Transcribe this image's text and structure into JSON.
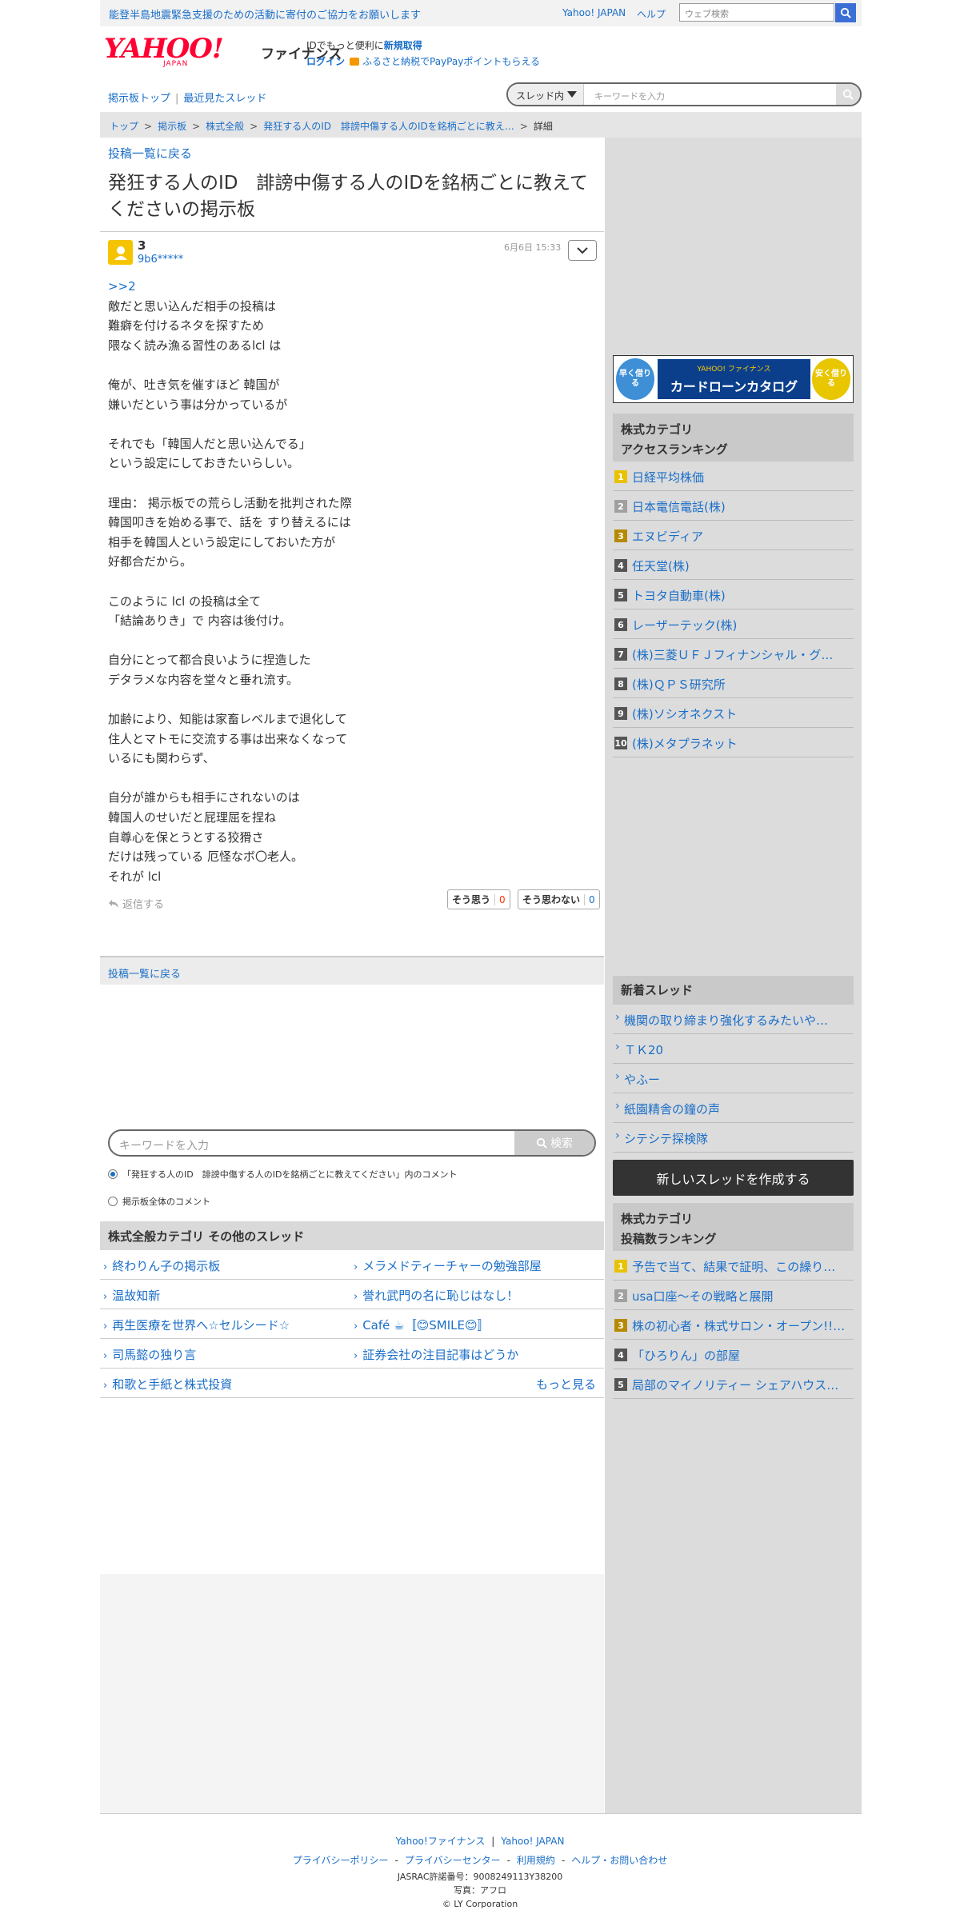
{
  "topbar": {
    "notice": "能登半島地震緊急支援のための活動に寄付のご協力をお願いします",
    "yahoo_japan": "Yahoo! JAPAN",
    "help": "ヘルプ",
    "web_search_placeholder": "ウェブ検索"
  },
  "header": {
    "logo": "YAHOO!",
    "logo_sub": "JAPAN",
    "service": "ファイナンス",
    "info_line1": "IDでもっと便利に",
    "info_signup": "新規取得",
    "info_login": "ログイン",
    "info_promo": "ふるさと納税でPayPayポイントもらえる"
  },
  "subnav": {
    "board_top": "掲示板トップ",
    "recent": "最近見たスレッド",
    "scope": "スレッド内",
    "keyword_placeholder": "キーワードを入力"
  },
  "breadcrumb": {
    "items": [
      "トップ",
      "掲示板",
      "株式全般",
      "発狂する人のID　誹謗中傷する人のIDを銘柄ごとに教え…"
    ],
    "current": "詳細"
  },
  "post": {
    "back_link": "投稿一覧に戻る",
    "title": "発狂する人のID　誹謗中傷する人のIDを銘柄ごとに教えてくださいの掲示板",
    "number": "3",
    "user_id": "9b6*****",
    "date": "6月6日 15:33",
    "anchor": ">>2",
    "body_lines": [
      "敵だと思い込んだ相手の投稿は",
      "難癖を付けるネタを探すため",
      "隈なく読み漁る習性のあるlcl は",
      "",
      "俺が、吐き気を催すほど 韓国が",
      "嫌いだという事は分かっているが",
      "",
      "それでも「韓国人だと思い込んでる」",
      "という設定にしておきたいらしい。",
      "",
      "理由： 掲示板での荒らし活動を批判された際",
      "韓国叩きを始める事で、話を すり替えるには",
      "相手を韓国人という設定にしておいた方が",
      "好都合だから。",
      "",
      "このように lcl の投稿は全て",
      "「結論ありき」で 内容は後付け。",
      "",
      "自分にとって都合良いように捏造した",
      "デタラメな内容を堂々と垂れ流す。",
      "",
      "加齢により、知能は家畜レベルまで退化して",
      "住人とマトモに交流する事は出来なくなって",
      "いるにも関わらず、",
      "",
      "自分が誰からも相手にされないのは",
      "韓国人のせいだと屁理屈を捏ね",
      "自尊心を保とうとする狡猾さ",
      "だけは残っている 厄怪なボ〇老人。",
      "それが lcl"
    ],
    "reply": "返信する",
    "agree_label": "そう思う",
    "agree_count": "0",
    "disagree_label": "そう思わない",
    "disagree_count": "0",
    "back_link_bottom": "投稿一覧に戻る"
  },
  "bottom_search": {
    "placeholder": "キーワードを入力",
    "button": "検索",
    "option1": "「発狂する人のID　誹謗中傷する人のIDを銘柄ごとに教えてください」内のコメント",
    "option2": "掲示板全体のコメント"
  },
  "category": {
    "heading": "株式全般カテゴリ  その他のスレッド",
    "rows": [
      [
        "終わりん子の掲示板",
        "メラメドティーチャーの勉強部屋"
      ],
      [
        "温故知新",
        "誉れ武門の名に恥じはなし！"
      ],
      [
        "再生医療を世界へ☆セルシード☆",
        "Café ☕〚😊SMILE😊〛"
      ],
      [
        "司馬懿の独り言",
        "証券会社の注目記事はどうか"
      ]
    ],
    "last_left": "和歌と手紙と株式投資",
    "more": "もっと見る"
  },
  "sidebar": {
    "ad_left": "早く借りる",
    "ad_top": "YAHOO! ファイナンス",
    "ad_main": "カードローンカタログ",
    "ad_right": "安く借りる",
    "access_heading_1": "株式カテゴリ",
    "access_heading_2": "アクセスランキング",
    "access_ranking": [
      "日経平均株価",
      "日本電信電話(株)",
      "エヌビディア",
      "任天堂(株)",
      "トヨタ自動車(株)",
      "レーザーテック(株)",
      "(株)三菱ＵＦＪフィナンシャル・グ…",
      "(株)ＱＰＳ研究所",
      "(株)ソシオネクスト",
      "(株)メタプラネット"
    ],
    "new_heading": "新着スレッド",
    "new_threads": [
      "機関の取り締まり強化するみたいや…",
      "ＴＫ20",
      "やふー",
      "紙園精舎の鐘の声",
      "シテシテ探検隊"
    ],
    "create_button": "新しいスレッドを作成する",
    "post_heading_1": "株式カテゴリ",
    "post_heading_2": "投稿数ランキング",
    "post_ranking": [
      "予告で当て、結果で証明、この繰り…",
      "usa口座〜その戦略と展開",
      "株の初心者・株式サロン・オープン!!…",
      "「ひろりん」の部屋",
      "局部のマイノリティー シェアハウス…"
    ]
  },
  "footer": {
    "link1": "Yahoo!ファイナンス",
    "link2": "Yahoo! JAPAN",
    "policy": [
      "プライバシーポリシー",
      "プライバシーセンター",
      "利用規約",
      "ヘルプ・お問い合わせ"
    ],
    "jasrac": "JASRAC許諾番号：9008249113Y38200",
    "photo": "写真：アフロ",
    "copyright": "© LY Corporation"
  },
  "colors": {
    "link": "#1a6ec8",
    "brand": "#ff0033",
    "agree": "#ff3300",
    "rank1": "#e8c200",
    "rank2": "#a0a0a0",
    "rank3": "#b58a00",
    "rank_other": "#555555"
  }
}
